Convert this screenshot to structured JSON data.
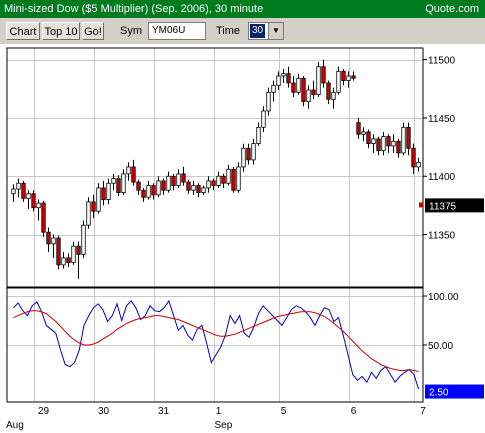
{
  "title_bar": {
    "title": "Mini-sized Dow ($5 Multiplier) (Sep. 2006), 30 minute",
    "site": "Quote.com"
  },
  "toolbar": {
    "chart_label": "Chart",
    "top10_label": "Top 10",
    "go_label": "Go!",
    "sym_label": "Sym",
    "sym_value": "YM06U",
    "time_label": "Time",
    "time_value": "30"
  },
  "colors": {
    "title_bar": "#007a1f",
    "up_candle": "#ffffff",
    "down_candle": "#cc0000",
    "oscillator_fast": "#0000cc",
    "oscillator_slow": "#cc0000",
    "price_tag": "#000000",
    "osc_tag": "#0000ff"
  },
  "chart_data": [
    {
      "type": "candlestick",
      "ylim": [
        11305,
        11510
      ],
      "yticks": [
        "11500",
        "11450",
        "11400",
        "11350"
      ],
      "last_price": "11375",
      "x_labels": [
        "29",
        "30",
        "31",
        "1",
        "5",
        "6",
        "7"
      ],
      "month_labels": [
        "Aug",
        "Sep"
      ],
      "grid": true,
      "candles": [
        {
          "o": 11385,
          "h": 11393,
          "l": 11378,
          "c": 11389
        },
        {
          "o": 11389,
          "h": 11398,
          "l": 11382,
          "c": 11394
        },
        {
          "o": 11394,
          "h": 11396,
          "l": 11378,
          "c": 11381
        },
        {
          "o": 11381,
          "h": 11388,
          "l": 11372,
          "c": 11385
        },
        {
          "o": 11385,
          "h": 11388,
          "l": 11370,
          "c": 11373
        },
        {
          "o": 11373,
          "h": 11380,
          "l": 11362,
          "c": 11377
        },
        {
          "o": 11377,
          "h": 11379,
          "l": 11348,
          "c": 11352
        },
        {
          "o": 11352,
          "h": 11356,
          "l": 11335,
          "c": 11342
        },
        {
          "o": 11342,
          "h": 11350,
          "l": 11330,
          "c": 11347
        },
        {
          "o": 11347,
          "h": 11349,
          "l": 11320,
          "c": 11324
        },
        {
          "o": 11324,
          "h": 11335,
          "l": 11321,
          "c": 11330
        },
        {
          "o": 11330,
          "h": 11334,
          "l": 11322,
          "c": 11326
        },
        {
          "o": 11326,
          "h": 11344,
          "l": 11324,
          "c": 11340
        },
        {
          "o": 11340,
          "h": 11344,
          "l": 11312,
          "c": 11333
        },
        {
          "o": 11333,
          "h": 11362,
          "l": 11330,
          "c": 11358
        },
        {
          "o": 11358,
          "h": 11382,
          "l": 11355,
          "c": 11378
        },
        {
          "o": 11378,
          "h": 11384,
          "l": 11364,
          "c": 11370
        },
        {
          "o": 11370,
          "h": 11394,
          "l": 11368,
          "c": 11390
        },
        {
          "o": 11390,
          "h": 11396,
          "l": 11375,
          "c": 11380
        },
        {
          "o": 11380,
          "h": 11398,
          "l": 11376,
          "c": 11394
        },
        {
          "o": 11394,
          "h": 11402,
          "l": 11388,
          "c": 11398
        },
        {
          "o": 11398,
          "h": 11401,
          "l": 11383,
          "c": 11386
        },
        {
          "o": 11386,
          "h": 11406,
          "l": 11384,
          "c": 11402
        },
        {
          "o": 11402,
          "h": 11412,
          "l": 11396,
          "c": 11408
        },
        {
          "o": 11408,
          "h": 11414,
          "l": 11392,
          "c": 11395
        },
        {
          "o": 11395,
          "h": 11397,
          "l": 11384,
          "c": 11388
        },
        {
          "o": 11388,
          "h": 11390,
          "l": 11378,
          "c": 11382
        },
        {
          "o": 11382,
          "h": 11396,
          "l": 11380,
          "c": 11392
        },
        {
          "o": 11392,
          "h": 11394,
          "l": 11380,
          "c": 11384
        },
        {
          "o": 11384,
          "h": 11400,
          "l": 11382,
          "c": 11396
        },
        {
          "o": 11396,
          "h": 11398,
          "l": 11384,
          "c": 11388
        },
        {
          "o": 11388,
          "h": 11404,
          "l": 11386,
          "c": 11400
        },
        {
          "o": 11400,
          "h": 11402,
          "l": 11388,
          "c": 11392
        },
        {
          "o": 11392,
          "h": 11406,
          "l": 11390,
          "c": 11402
        },
        {
          "o": 11402,
          "h": 11408,
          "l": 11392,
          "c": 11395
        },
        {
          "o": 11395,
          "h": 11397,
          "l": 11385,
          "c": 11388
        },
        {
          "o": 11388,
          "h": 11396,
          "l": 11384,
          "c": 11392
        },
        {
          "o": 11392,
          "h": 11394,
          "l": 11382,
          "c": 11386
        },
        {
          "o": 11386,
          "h": 11392,
          "l": 11384,
          "c": 11390
        },
        {
          "o": 11390,
          "h": 11400,
          "l": 11386,
          "c": 11396
        },
        {
          "o": 11396,
          "h": 11398,
          "l": 11388,
          "c": 11392
        },
        {
          "o": 11392,
          "h": 11404,
          "l": 11390,
          "c": 11400
        },
        {
          "o": 11400,
          "h": 11402,
          "l": 11390,
          "c": 11394
        },
        {
          "o": 11394,
          "h": 11410,
          "l": 11392,
          "c": 11406
        },
        {
          "o": 11406,
          "h": 11408,
          "l": 11386,
          "c": 11388
        },
        {
          "o": 11388,
          "h": 11412,
          "l": 11386,
          "c": 11408
        },
        {
          "o": 11408,
          "h": 11428,
          "l": 11404,
          "c": 11424
        },
        {
          "o": 11424,
          "h": 11428,
          "l": 11410,
          "c": 11414
        },
        {
          "o": 11414,
          "h": 11432,
          "l": 11410,
          "c": 11428
        },
        {
          "o": 11428,
          "h": 11446,
          "l": 11426,
          "c": 11442
        },
        {
          "o": 11442,
          "h": 11460,
          "l": 11438,
          "c": 11456
        },
        {
          "o": 11456,
          "h": 11476,
          "l": 11452,
          "c": 11472
        },
        {
          "o": 11472,
          "h": 11482,
          "l": 11464,
          "c": 11478
        },
        {
          "o": 11478,
          "h": 11490,
          "l": 11474,
          "c": 11486
        },
        {
          "o": 11486,
          "h": 11492,
          "l": 11480,
          "c": 11488
        },
        {
          "o": 11488,
          "h": 11494,
          "l": 11476,
          "c": 11480
        },
        {
          "o": 11480,
          "h": 11486,
          "l": 11468,
          "c": 11472
        },
        {
          "o": 11472,
          "h": 11488,
          "l": 11470,
          "c": 11484
        },
        {
          "o": 11484,
          "h": 11486,
          "l": 11460,
          "c": 11464
        },
        {
          "o": 11464,
          "h": 11478,
          "l": 11458,
          "c": 11474
        },
        {
          "o": 11474,
          "h": 11482,
          "l": 11466,
          "c": 11470
        },
        {
          "o": 11470,
          "h": 11498,
          "l": 11468,
          "c": 11494
        },
        {
          "o": 11494,
          "h": 11500,
          "l": 11476,
          "c": 11480
        },
        {
          "o": 11480,
          "h": 11482,
          "l": 11462,
          "c": 11466
        },
        {
          "o": 11466,
          "h": 11476,
          "l": 11458,
          "c": 11472
        },
        {
          "o": 11472,
          "h": 11494,
          "l": 11470,
          "c": 11490
        },
        {
          "o": 11490,
          "h": 11492,
          "l": 11478,
          "c": 11482
        },
        {
          "o": 11482,
          "h": 11490,
          "l": 11476,
          "c": 11486
        },
        {
          "o": 11486,
          "h": 11490,
          "l": 11482,
          "c": 11484
        },
        {
          "o": 11446,
          "h": 11450,
          "l": 11432,
          "c": 11436
        },
        {
          "o": 11436,
          "h": 11442,
          "l": 11430,
          "c": 11438
        },
        {
          "o": 11438,
          "h": 11440,
          "l": 11424,
          "c": 11428
        },
        {
          "o": 11428,
          "h": 11436,
          "l": 11420,
          "c": 11432
        },
        {
          "o": 11432,
          "h": 11434,
          "l": 11418,
          "c": 11422
        },
        {
          "o": 11422,
          "h": 11438,
          "l": 11418,
          "c": 11434
        },
        {
          "o": 11434,
          "h": 11436,
          "l": 11420,
          "c": 11426
        },
        {
          "o": 11426,
          "h": 11436,
          "l": 11420,
          "c": 11430
        },
        {
          "o": 11430,
          "h": 11432,
          "l": 11416,
          "c": 11420
        },
        {
          "o": 11420,
          "h": 11446,
          "l": 11418,
          "c": 11442
        },
        {
          "o": 11442,
          "h": 11446,
          "l": 11418,
          "c": 11424
        },
        {
          "o": 11424,
          "h": 11428,
          "l": 11402,
          "c": 11408
        },
        {
          "o": 11408,
          "h": 11416,
          "l": 11404,
          "c": 11412
        }
      ]
    },
    {
      "type": "line",
      "ylim": [
        0,
        100
      ],
      "yticks": [
        "100.00",
        "50.00"
      ],
      "last_value": "2.50",
      "series": [
        {
          "values": [
            88,
            93,
            85,
            80,
            90,
            94,
            84,
            70,
            66,
            62,
            45,
            30,
            28,
            32,
            45,
            70,
            80,
            88,
            92,
            86,
            74,
            80,
            92,
            75,
            90,
            95,
            88,
            76,
            80,
            90,
            85,
            84,
            88,
            95,
            80,
            65,
            70,
            60,
            55,
            66,
            70,
            52,
            32,
            40,
            48,
            60,
            80,
            72,
            80,
            62,
            58,
            68,
            82,
            90,
            85,
            80,
            75,
            70,
            78,
            86,
            90,
            88,
            84,
            78,
            70,
            80,
            88,
            86,
            74,
            78,
            60,
            40,
            20,
            14,
            18,
            12,
            22,
            16,
            24,
            28,
            20,
            12,
            18,
            22,
            25,
            20,
            5
          ]
        },
        {
          "values": [
            78,
            80,
            82,
            84,
            85,
            85,
            84,
            82,
            78,
            74,
            69,
            64,
            59,
            55,
            52,
            50,
            50,
            51,
            53,
            56,
            59,
            62,
            66,
            69,
            72,
            74,
            76,
            77,
            78,
            79,
            80,
            80,
            79,
            78,
            77,
            76,
            74,
            72,
            70,
            68,
            66,
            64,
            62,
            60,
            59,
            59,
            60,
            61,
            63,
            65,
            67,
            69,
            71,
            73,
            75,
            77,
            79,
            80,
            81,
            82,
            83,
            84,
            84,
            84,
            83,
            81,
            79,
            76,
            72,
            68,
            64,
            59,
            54,
            49,
            44,
            40,
            36,
            33,
            30,
            28,
            26,
            25,
            24,
            24,
            25,
            24,
            23
          ]
        }
      ]
    }
  ]
}
